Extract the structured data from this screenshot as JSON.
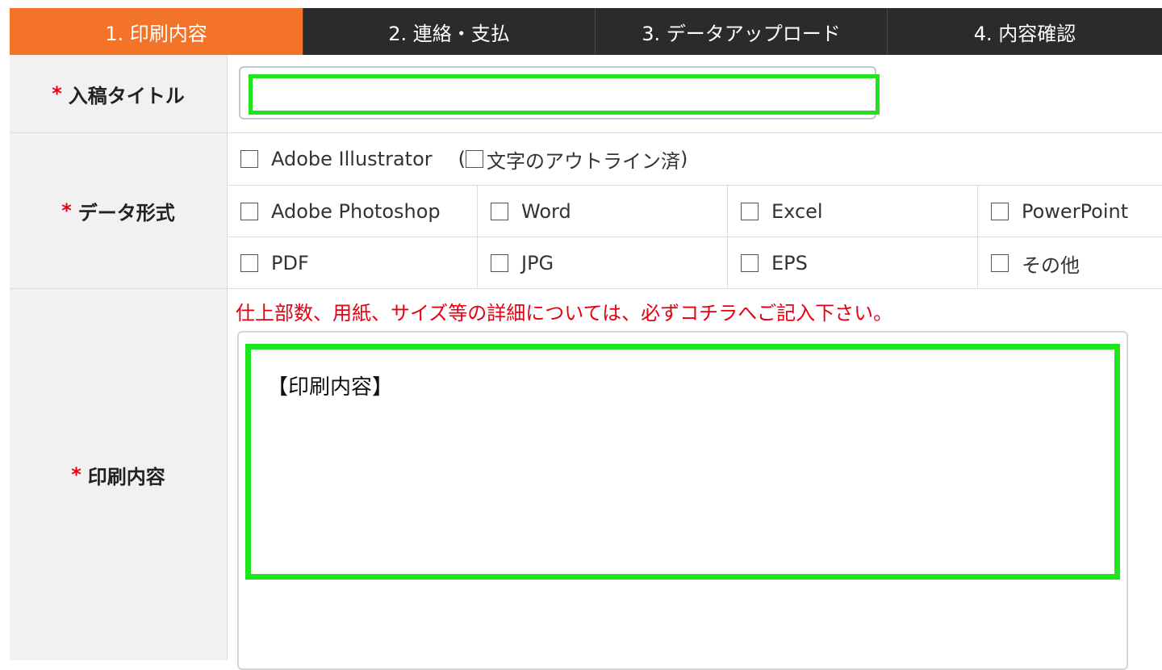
{
  "steps": [
    {
      "label": "1. 印刷内容",
      "active": true
    },
    {
      "label": "2. 連絡・支払",
      "active": false
    },
    {
      "label": "3. データアップロード",
      "active": false
    },
    {
      "label": "4. 内容確認",
      "active": false
    }
  ],
  "required_mark": "*",
  "fields": {
    "title": {
      "label": "入稿タイトル",
      "value": ""
    },
    "format": {
      "label": "データ形式",
      "illustrator": "Adobe Illustrator",
      "outline_open": "(",
      "outline_label": "文字のアウトライン済",
      "outline_close": ")",
      "options_row2": [
        "Adobe Photoshop",
        "Word",
        "Excel",
        "PowerPoint"
      ],
      "options_row3": [
        "PDF",
        "JPG",
        "EPS",
        "その他"
      ]
    },
    "print": {
      "label": "印刷内容",
      "note": "仕上部数、用紙、サイズ等の詳細については、必ずコチラへご記入下さい。",
      "value": "【印刷内容】"
    }
  },
  "colors": {
    "accent": "#f37329",
    "tab_bar": "#2b2b2b",
    "required": "#e60012",
    "highlight": "#1ee51e"
  }
}
